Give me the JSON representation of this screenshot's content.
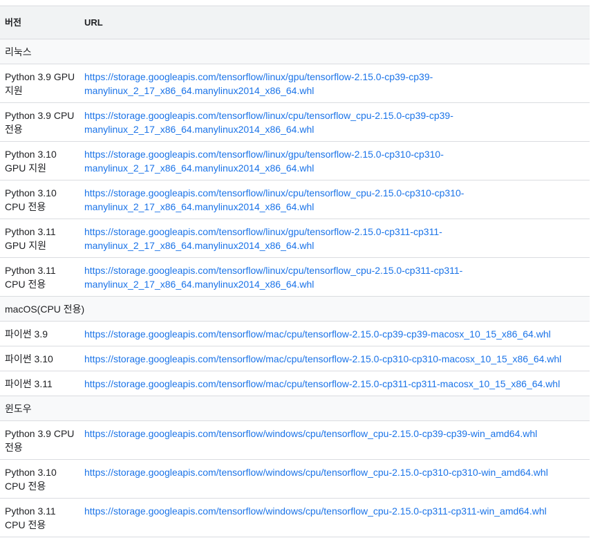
{
  "header": {
    "version": "버전",
    "url": "URL"
  },
  "sections": {
    "linux": "리눅스",
    "macos": "macOS(CPU 전용)",
    "windows": "윈도우"
  },
  "linux_rows": [
    {
      "v1": "Python 3.9 GPU",
      "v2": "지원",
      "u1": "https://storage.googleapis.com/tensorflow/linux/gpu/tensorflow-2.15.0-cp39-cp39-",
      "u2": "manylinux_2_17_x86_64.manylinux2014_x86_64.whl"
    },
    {
      "v1": "Python 3.9 CPU",
      "v2": "전용",
      "u1": "https://storage.googleapis.com/tensorflow/linux/cpu/tensorflow_cpu-2.15.0-cp39-cp39-",
      "u2": "manylinux_2_17_x86_64.manylinux2014_x86_64.whl"
    },
    {
      "v1": "Python 3.10",
      "v2": "GPU 지원",
      "u1": "https://storage.googleapis.com/tensorflow/linux/gpu/tensorflow-2.15.0-cp310-cp310-",
      "u2": "manylinux_2_17_x86_64.manylinux2014_x86_64.whl"
    },
    {
      "v1": "Python 3.10",
      "v2": "CPU 전용",
      "u1": "https://storage.googleapis.com/tensorflow/linux/cpu/tensorflow_cpu-2.15.0-cp310-cp310-",
      "u2": "manylinux_2_17_x86_64.manylinux2014_x86_64.whl"
    },
    {
      "v1": "Python 3.11",
      "v2": "GPU 지원",
      "u1": "https://storage.googleapis.com/tensorflow/linux/gpu/tensorflow-2.15.0-cp311-cp311-",
      "u2": "manylinux_2_17_x86_64.manylinux2014_x86_64.whl"
    },
    {
      "v1": "Python 3.11",
      "v2": "CPU 전용",
      "u1": "https://storage.googleapis.com/tensorflow/linux/cpu/tensorflow_cpu-2.15.0-cp311-cp311-",
      "u2": "manylinux_2_17_x86_64.manylinux2014_x86_64.whl"
    }
  ],
  "mac_rows": [
    {
      "v": "파이썬 3.9",
      "u": "https://storage.googleapis.com/tensorflow/mac/cpu/tensorflow-2.15.0-cp39-cp39-macosx_10_15_x86_64.whl"
    },
    {
      "v": "파이썬 3.10",
      "u": "https://storage.googleapis.com/tensorflow/mac/cpu/tensorflow-2.15.0-cp310-cp310-macosx_10_15_x86_64.whl"
    },
    {
      "v": "파이썬 3.11",
      "u": "https://storage.googleapis.com/tensorflow/mac/cpu/tensorflow-2.15.0-cp311-cp311-macosx_10_15_x86_64.whl"
    }
  ],
  "windows_rows": [
    {
      "v1": "Python 3.9 CPU",
      "v2": "전용",
      "u": "https://storage.googleapis.com/tensorflow/windows/cpu/tensorflow_cpu-2.15.0-cp39-cp39-win_amd64.whl"
    },
    {
      "v1": "Python 3.10",
      "v2": "CPU 전용",
      "u": "https://storage.googleapis.com/tensorflow/windows/cpu/tensorflow_cpu-2.15.0-cp310-cp310-win_amd64.whl"
    },
    {
      "v1": "Python 3.11",
      "v2": "CPU 전용",
      "u": "https://storage.googleapis.com/tensorflow/windows/cpu/tensorflow_cpu-2.15.0-cp311-cp311-win_amd64.whl"
    }
  ],
  "colors": {
    "link": "#1a73e8",
    "header_bg": "#f1f3f4",
    "section_bg": "#f8f9fa",
    "border": "#dadce0"
  }
}
